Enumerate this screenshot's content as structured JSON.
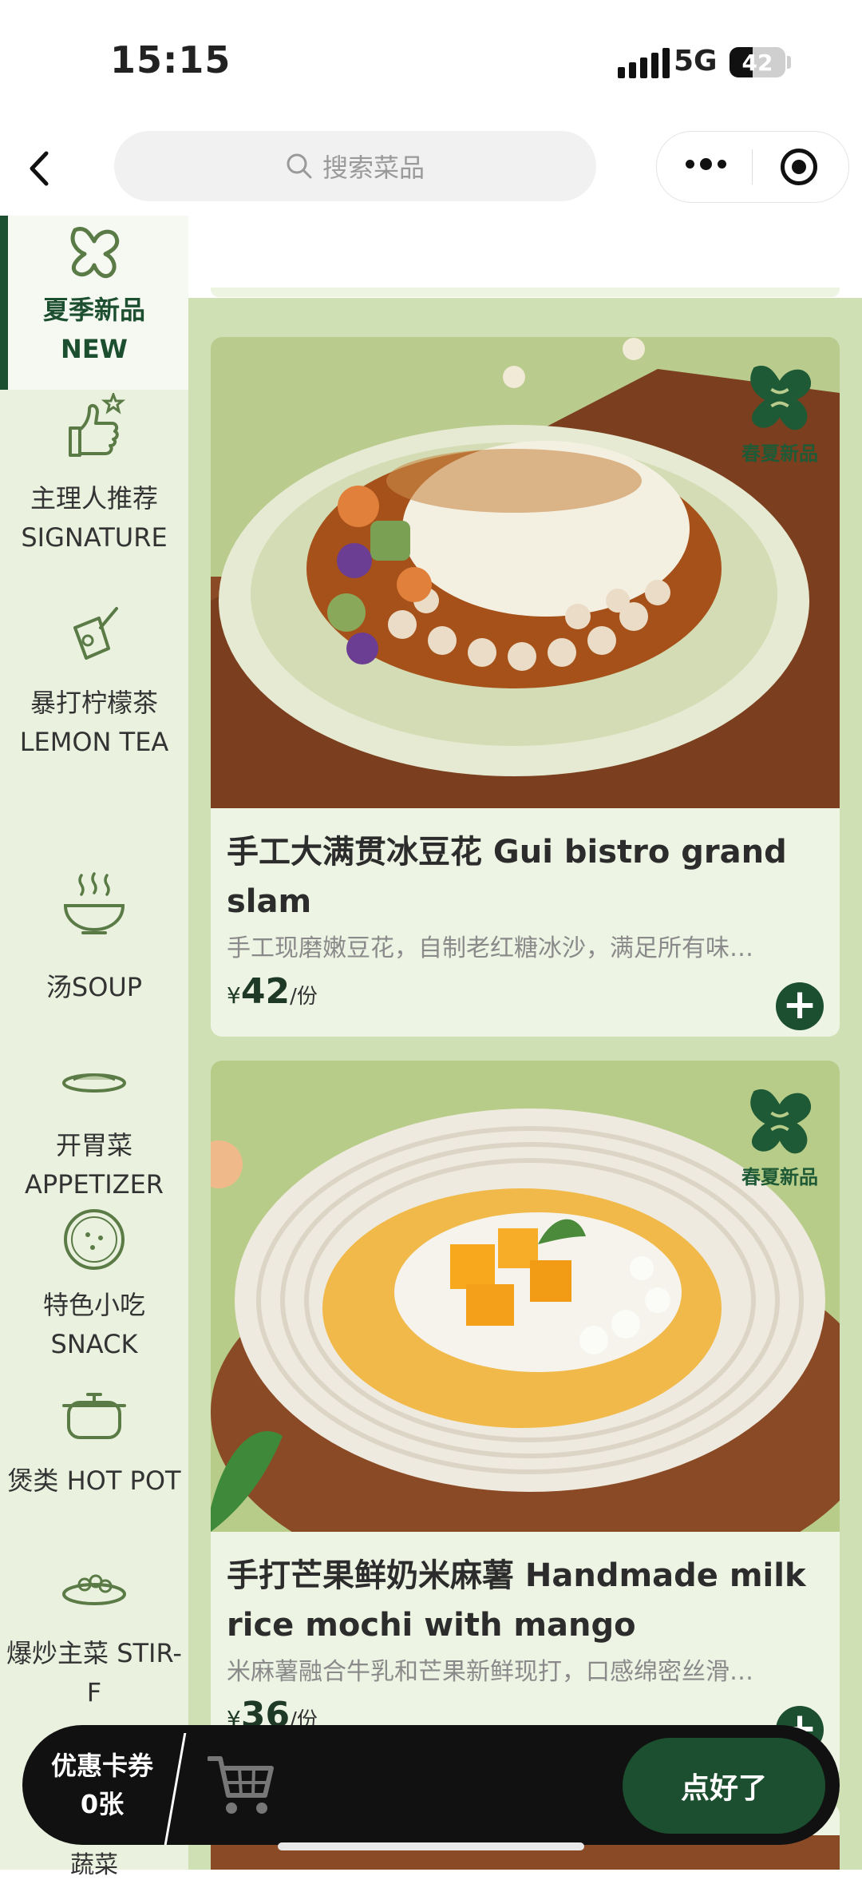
{
  "status_bar": {
    "time": "15:15",
    "network": "5G",
    "battery": "42",
    "battery_fraction": 0.42
  },
  "nav": {
    "search_placeholder": "搜索菜品"
  },
  "sidebar": {
    "items": [
      {
        "label": "夏季新品 NEW",
        "icon": "leaf-logo-icon",
        "active": true
      },
      {
        "label": "主理人推荐 SIGNATURE",
        "icon": "thumbs-up-icon",
        "active": false
      },
      {
        "label": "暴打柠檬茶 LEMON TEA",
        "icon": "lemon-tea-icon",
        "active": false
      },
      {
        "label": "汤SOUP",
        "icon": "soup-bowl-icon",
        "active": false
      },
      {
        "label": "开胃菜 APPETIZER",
        "icon": "appetizer-plate-icon",
        "active": false
      },
      {
        "label": "特色小吃 SNACK",
        "icon": "snack-plate-icon",
        "active": false
      },
      {
        "label": "煲类 HOT POT",
        "icon": "hot-pot-icon",
        "active": false
      },
      {
        "label": "爆炒主菜 STIR-F",
        "icon": "stir-fry-icon",
        "active": false
      },
      {
        "label": "蔬菜",
        "icon": "",
        "active": false
      }
    ]
  },
  "dishes": [
    {
      "name": "手工大满贯冰豆花 Gui bistro grand slam",
      "description": "手工现磨嫩豆花，自制老红糖冰沙，满足所有味…",
      "currency": "¥",
      "price": "42",
      "unit": "/份",
      "badge": "春夏新品"
    },
    {
      "name": "手打芒果鲜奶米麻薯 Handmade milk rice mochi with mango",
      "description": "米麻薯融合牛乳和芒果新鲜现打，口感绵密丝滑…",
      "currency": "¥",
      "price": "36",
      "unit": "/份",
      "badge": "春夏新品"
    }
  ],
  "cart_bar": {
    "coupon_title": "优惠卡券",
    "coupon_count": "0张",
    "checkout_label": "点好了"
  },
  "colors": {
    "brand_green": "#1c4f2f",
    "sidebar_bg": "#eaf1df",
    "content_bg": "#cfe0b4"
  }
}
